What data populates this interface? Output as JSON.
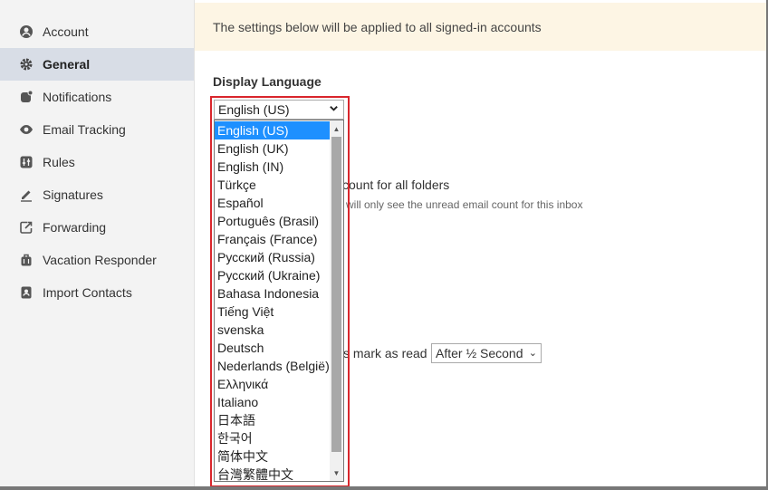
{
  "sidebar": {
    "items": [
      {
        "label": "Account",
        "icon": "user-circle-icon"
      },
      {
        "label": "General",
        "icon": "gear-icon"
      },
      {
        "label": "Notifications",
        "icon": "notification-icon"
      },
      {
        "label": "Email Tracking",
        "icon": "eye-icon"
      },
      {
        "label": "Rules",
        "icon": "rules-icon"
      },
      {
        "label": "Signatures",
        "icon": "pen-icon"
      },
      {
        "label": "Forwarding",
        "icon": "forward-icon"
      },
      {
        "label": "Vacation Responder",
        "icon": "suitcase-icon"
      },
      {
        "label": "Import Contacts",
        "icon": "contacts-icon"
      }
    ],
    "active": "General"
  },
  "banner": {
    "text": "The settings below will be applied to all signed-in accounts"
  },
  "display_language": {
    "title": "Display Language",
    "selected": "English (US)",
    "options": [
      "English (US)",
      "English (UK)",
      "English (IN)",
      "Türkçe",
      "Español",
      "Português (Brasil)",
      "Français (France)",
      "Русский (Russia)",
      "Русский (Ukraine)",
      "Bahasa Indonesia",
      "Tiếng Việt",
      "svenska",
      "Deutsch",
      "Nederlands (België)",
      "Ελληνικά",
      "Italiano",
      "日本語",
      "한국어",
      "简体中文",
      "台灣繁體中文"
    ]
  },
  "behind": {
    "unread_count_label": "count for all folders",
    "unread_count_sub": "will only see the unread email count for this inbox",
    "mark_as_read_label": "s mark as read",
    "mark_as_read_value": "After ½ Second"
  }
}
